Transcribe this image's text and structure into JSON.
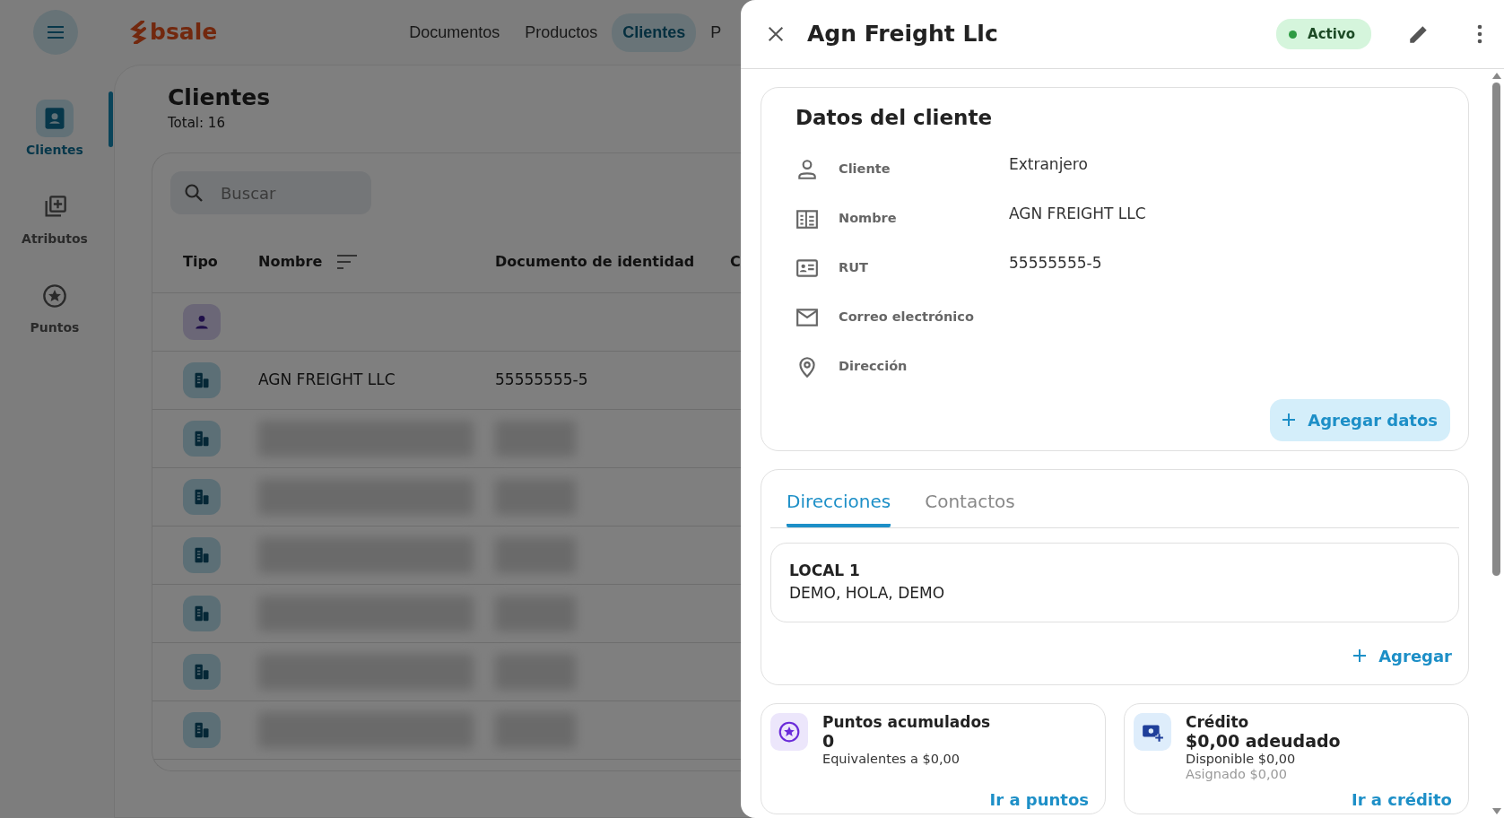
{
  "topbar": {
    "logo": "bsale",
    "nav": [
      {
        "label": "Documentos",
        "selected": false
      },
      {
        "label": "Productos",
        "selected": false
      },
      {
        "label": "Clientes",
        "selected": true
      },
      {
        "label": "P",
        "selected": false
      }
    ]
  },
  "sidebar": {
    "items": [
      {
        "label": "Clientes",
        "selected": true
      },
      {
        "label": "Atributos",
        "selected": false
      },
      {
        "label": "Puntos",
        "selected": false
      }
    ]
  },
  "page": {
    "title": "Clientes",
    "total": "Total: 16"
  },
  "search": {
    "placeholder": "Buscar"
  },
  "table": {
    "columns": [
      "Tipo",
      "Nombre",
      "Documento de identidad",
      "C"
    ],
    "rows": [
      {
        "kind": "person",
        "redacted": false
      },
      {
        "kind": "company",
        "redacted": false,
        "name": "AGN FREIGHT LLC",
        "document": "55555555-5"
      },
      {
        "kind": "company",
        "redacted": true
      },
      {
        "kind": "company",
        "redacted": true
      },
      {
        "kind": "company",
        "redacted": true
      },
      {
        "kind": "company",
        "redacted": true
      },
      {
        "kind": "company",
        "redacted": true
      },
      {
        "kind": "company",
        "redacted": true
      }
    ]
  },
  "drawer": {
    "title": "Agn Freight Llc",
    "status": {
      "label": "Activo",
      "active": true
    },
    "details": {
      "title": "Datos del cliente",
      "fields": [
        {
          "kind": "person",
          "label": "Cliente",
          "value": "Extranjero"
        },
        {
          "kind": "building",
          "label": "Nombre",
          "value": "AGN FREIGHT LLC"
        },
        {
          "kind": "id",
          "label": "RUT",
          "value": "55555555-5"
        },
        {
          "kind": "mail",
          "label": "Correo electrónico"
        },
        {
          "kind": "pin",
          "label": "Dirección"
        }
      ],
      "button": "Agregar datos"
    },
    "tabs": [
      {
        "label": "Direcciones",
        "selected": true
      },
      {
        "label": "Contactos",
        "selected": false
      }
    ],
    "addresses": [
      {
        "name": "LOCAL 1",
        "address": "DEMO, HOLA, DEMO"
      }
    ],
    "add_button": "Agregar",
    "summary": [
      {
        "kind": "points",
        "title": "Puntos acumulados",
        "value": "0",
        "lines": [
          {
            "text": "Equivalentes a $0,00",
            "muted": false
          }
        ],
        "link": "Ir a puntos"
      },
      {
        "kind": "credit",
        "title": "Crédito",
        "value": "$0,00 adeudado",
        "lines": [
          {
            "text": "Disponible $0,00",
            "muted": false
          },
          {
            "text": "Asignado $0,00",
            "muted": true
          }
        ],
        "link": "Ir a crédito"
      }
    ]
  }
}
